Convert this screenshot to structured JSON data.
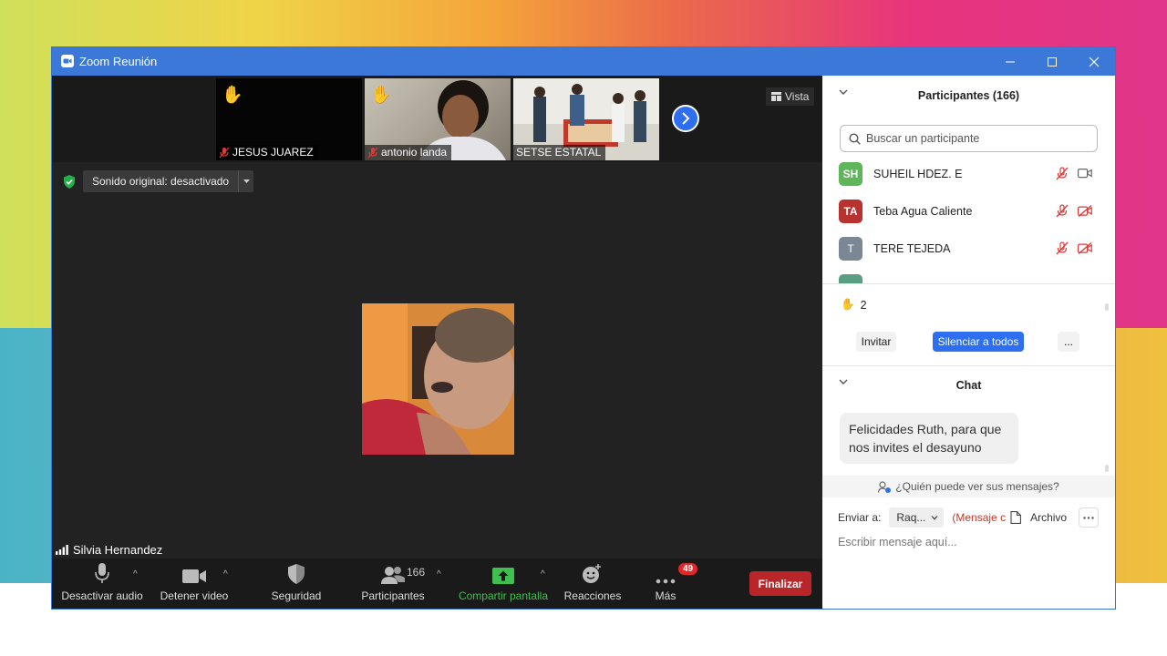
{
  "window": {
    "title": "Zoom Reunión"
  },
  "thumbnails": [
    {
      "name": "JESUS JUAREZ",
      "muted": true,
      "hand_raised": true
    },
    {
      "name": "antonio landa",
      "muted": true,
      "hand_raised": true
    },
    {
      "name": "SETSE ESTATAL",
      "muted": false,
      "hand_raised": false
    }
  ],
  "view_label": "Vista",
  "original_sound": "Sonido original: desactivado",
  "active_speaker": "Silvia Hernandez",
  "toolbar": {
    "mute": "Desactivar audio",
    "video": "Detener video",
    "security": "Seguridad",
    "participants": "Participantes",
    "participants_count": "166",
    "share": "Compartir pantalla",
    "reactions": "Reacciones",
    "more": "Más",
    "more_badge": "49",
    "end": "Finalizar"
  },
  "participants_panel": {
    "title": "Participantes (166)",
    "search_placeholder": "Buscar un participante",
    "items": [
      {
        "initials": "SH",
        "name": "SUHEIL HDEZ. E",
        "color": "#5fb55a"
      },
      {
        "initials": "TA",
        "name": "Teba Agua Caliente",
        "color": "#b8322f"
      },
      {
        "initials": "T",
        "name": "TERE TEJEDA",
        "color": "#7b8794"
      }
    ],
    "hands_count": "2",
    "invite": "Invitar",
    "mute_all": "Silenciar a todos",
    "more": "..."
  },
  "chat": {
    "title": "Chat",
    "messages": [
      {
        "text": "Felicidades Ruth, para que nos invites el desayuno"
      }
    ],
    "who_can_see": "¿Quién puede ver sus mensajes?",
    "send_to_label": "Enviar a:",
    "send_to_value": "Raq...",
    "private_hint": "(Mensaje c",
    "file": "Archivo",
    "compose_placeholder": "Escribir mensaje aquí..."
  },
  "colors": {
    "titlebar": "#3c78d8",
    "accent": "#2d6ff0",
    "share_green": "#3fbf50",
    "end_red": "#b8262a",
    "muted_red": "#d93a3a"
  }
}
